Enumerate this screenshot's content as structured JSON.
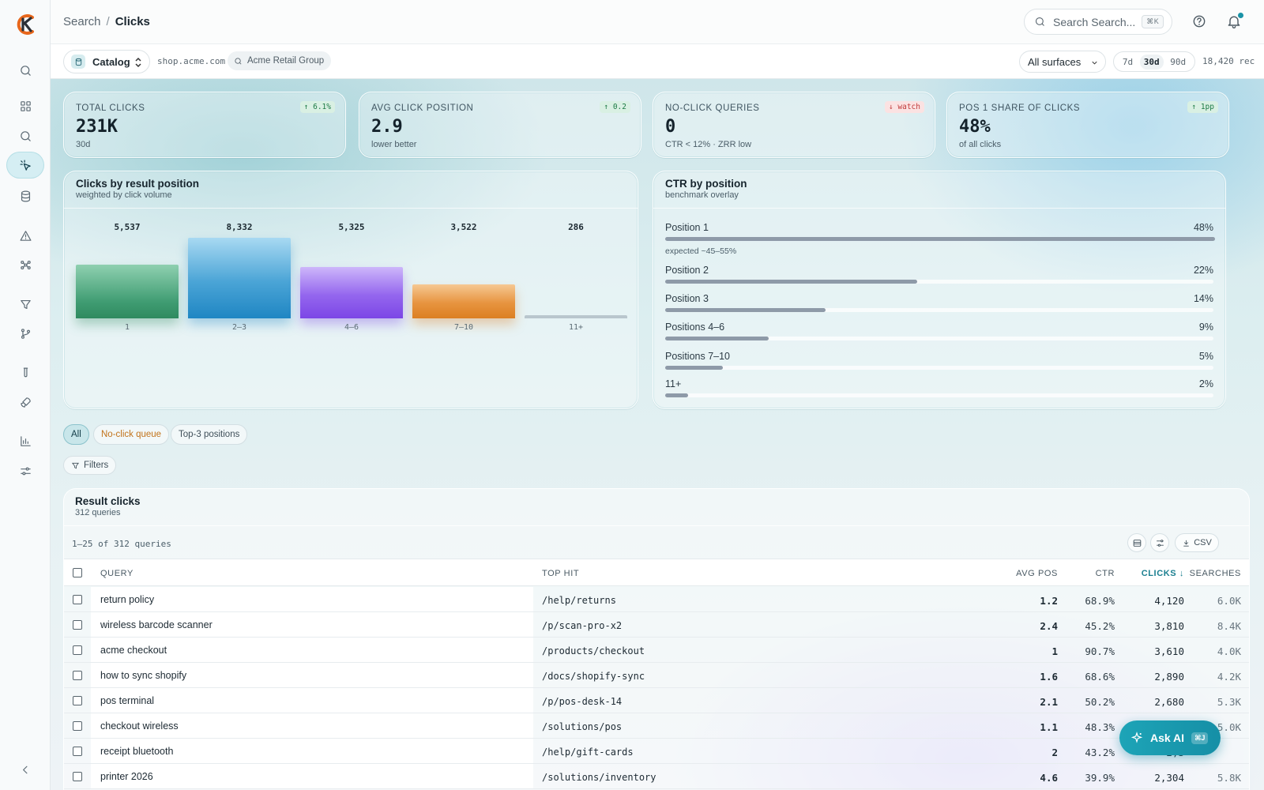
{
  "header": {
    "breadcrumb_root": "Search",
    "breadcrumb_sep": "/",
    "breadcrumb_current": "Clicks",
    "search_placeholder": "Search Search...",
    "search_shortcut": "⌘K"
  },
  "filterbar": {
    "catalog_label": "Catalog",
    "domain": "shop.acme.com",
    "org": "Acme Retail Group",
    "surface_select": "All surfaces",
    "ranges": [
      "7d",
      "30d",
      "90d"
    ],
    "selected_range": "30d",
    "records": "18,420 rec"
  },
  "kpis": [
    {
      "label": "TOTAL CLICKS",
      "value": "231K",
      "sub": "30d",
      "badge": "↑ 6.1%",
      "trend": "up"
    },
    {
      "label": "AVG CLICK POSITION",
      "value": "2.9",
      "sub": "lower better",
      "badge": "↑ 0.2",
      "trend": "up"
    },
    {
      "label": "NO-CLICK QUERIES",
      "value": "0",
      "sub": "CTR < 12% · ZRR low",
      "badge": "↓ watch",
      "trend": "down"
    },
    {
      "label": "POS 1 SHARE OF CLICKS",
      "value": "48%",
      "sub": "of all clicks",
      "badge": "↑ 1pp",
      "trend": "up"
    }
  ],
  "chart_data": [
    {
      "type": "bar",
      "title": "Clicks by result position",
      "subtitle": "weighted by click volume",
      "categories": [
        "1",
        "2–3",
        "4–6",
        "7–10",
        "11+"
      ],
      "values": [
        5537,
        8332,
        5325,
        3522,
        286
      ],
      "value_labels": [
        "5,537",
        "8,332",
        "5,325",
        "3,522",
        "286"
      ],
      "colors": [
        "#3f9c72",
        "#1f86c3",
        "#7c46e6",
        "#dc7f22",
        "#b9c6cd"
      ],
      "ylim": [
        0,
        8332
      ],
      "grid": false
    },
    {
      "type": "bar",
      "orientation": "horizontal",
      "title": "CTR by position",
      "subtitle": "benchmark overlay",
      "categories": [
        "Position 1",
        "Position 2",
        "Position 3",
        "Positions 4–6",
        "Positions 7–10",
        "11+"
      ],
      "values": [
        48,
        22,
        14,
        9,
        5,
        2
      ],
      "value_labels": [
        "48%",
        "22%",
        "14%",
        "9%",
        "5%",
        "2%"
      ],
      "annotation": "expected ~45–55%",
      "unit": "%",
      "xlim": [
        0,
        48
      ]
    }
  ],
  "segments": {
    "all": "All",
    "noclick": "No-click queue",
    "top3": "Top-3 positions",
    "filters": "Filters"
  },
  "table": {
    "title": "Result clicks",
    "subtitle": "312 queries",
    "pager": "1–25 of 312 queries",
    "csv": "CSV",
    "headers": {
      "query": "QUERY",
      "top_hit": "TOP HIT",
      "avg_pos": "AVG POS",
      "ctr": "CTR",
      "clicks": "CLICKS ↓",
      "searches": "SEARCHES"
    },
    "rows": [
      {
        "query": "return policy",
        "top_hit": "/help/returns",
        "avg_pos": "1.2",
        "ctr": "68.9%",
        "clicks": "4,120",
        "searches": "6.0K"
      },
      {
        "query": "wireless barcode scanner",
        "top_hit": "/p/scan-pro-x2",
        "avg_pos": "2.4",
        "ctr": "45.2%",
        "clicks": "3,810",
        "searches": "8.4K"
      },
      {
        "query": "acme checkout",
        "top_hit": "/products/checkout",
        "avg_pos": "1",
        "ctr": "90.7%",
        "clicks": "3,610",
        "searches": "4.0K"
      },
      {
        "query": "how to sync shopify",
        "top_hit": "/docs/shopify-sync",
        "avg_pos": "1.6",
        "ctr": "68.6%",
        "clicks": "2,890",
        "searches": "4.2K"
      },
      {
        "query": "pos terminal",
        "top_hit": "/p/pos-desk-14",
        "avg_pos": "2.1",
        "ctr": "50.2%",
        "clicks": "2,680",
        "searches": "5.3K"
      },
      {
        "query": "checkout wireless",
        "top_hit": "/solutions/pos",
        "avg_pos": "1.1",
        "ctr": "48.3%",
        "clicks": "2,412",
        "searches": "5.0K"
      },
      {
        "query": "receipt bluetooth",
        "top_hit": "/help/gift-cards",
        "avg_pos": "2",
        "ctr": "43.2%",
        "clicks": "2,3",
        "searches": ""
      },
      {
        "query": "printer 2026",
        "top_hit": "/solutions/inventory",
        "avg_pos": "4.6",
        "ctr": "39.9%",
        "clicks": "2,304",
        "searches": "5.8K"
      }
    ]
  },
  "ask_ai": {
    "label": "Ask AI",
    "shortcut": "⌘J"
  }
}
